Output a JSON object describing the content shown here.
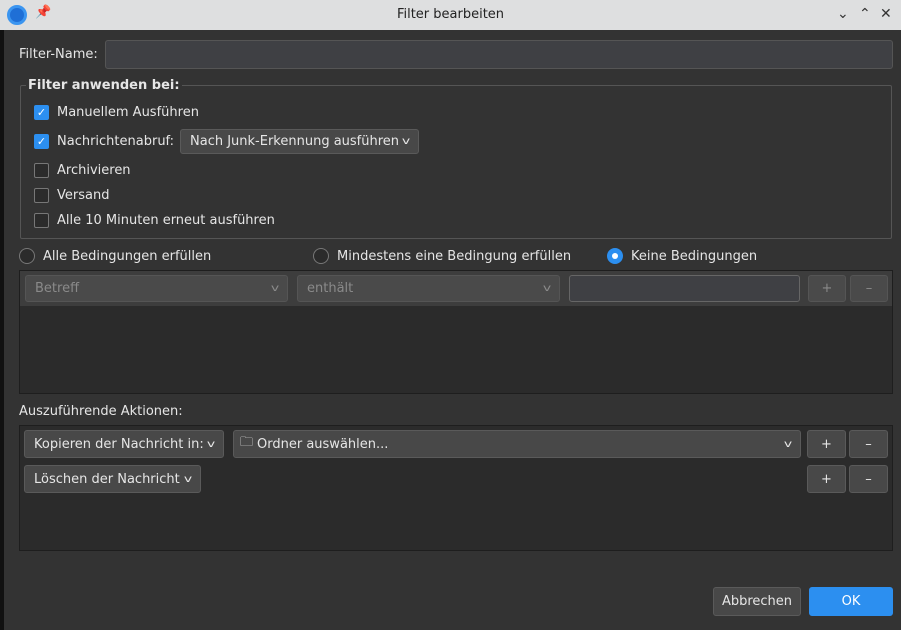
{
  "window": {
    "title": "Filter bearbeiten"
  },
  "filter_name": {
    "label": "Filter-Name:",
    "value": ""
  },
  "apply": {
    "legend": "Filter anwenden bei:",
    "manual": {
      "label": "Manuellem Ausführen",
      "checked": true
    },
    "fetch": {
      "label": "Nachrichtenabruf:",
      "checked": true,
      "select": "Nach Junk-Erkennung ausführen"
    },
    "archive": {
      "label": "Archivieren",
      "checked": false
    },
    "send": {
      "label": "Versand",
      "checked": false
    },
    "periodic": {
      "label": "Alle 10 Minuten erneut ausführen",
      "checked": false
    }
  },
  "match": {
    "all": "Alle Bedingungen erfüllen",
    "any": "Mindestens eine Bedingung erfüllen",
    "none": "Keine Bedingungen",
    "selected": "none"
  },
  "condition": {
    "field": "Betreff",
    "operator": "enthält",
    "value": "",
    "add": "+",
    "remove": "–"
  },
  "actions": {
    "label": "Auszuführende Aktionen:",
    "rows": [
      {
        "action": "Kopieren der Nachricht in:",
        "target": "Ordner auswählen...",
        "add": "+",
        "remove": "–"
      },
      {
        "action": "Löschen der Nachricht",
        "add": "+",
        "remove": "–"
      }
    ]
  },
  "buttons": {
    "cancel": "Abbrechen",
    "ok": "OK"
  },
  "colors": {
    "accent": "#2c8ff0"
  }
}
